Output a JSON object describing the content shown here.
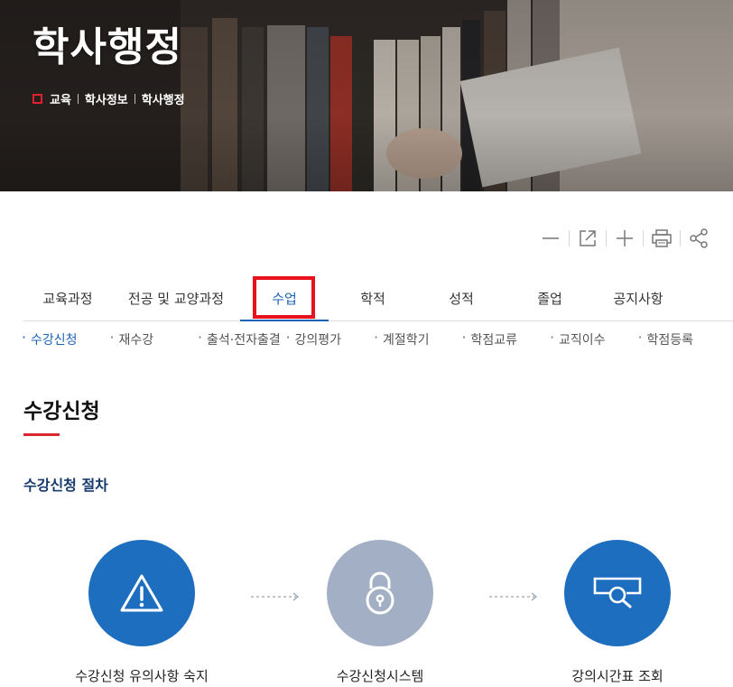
{
  "hero": {
    "title": "학사행정",
    "breadcrumb": [
      "교육",
      "학사정보",
      "학사행정"
    ]
  },
  "utility": {
    "icons": [
      "zoom-out-icon",
      "external-link-icon",
      "zoom-in-icon",
      "print-icon",
      "share-icon"
    ]
  },
  "tabs": [
    {
      "label": "교육과정",
      "active": false
    },
    {
      "label": "전공 및 교양과정",
      "active": false
    },
    {
      "label": "수업",
      "active": true
    },
    {
      "label": "학적",
      "active": false
    },
    {
      "label": "성적",
      "active": false
    },
    {
      "label": "졸업",
      "active": false
    },
    {
      "label": "공지사항",
      "active": false
    }
  ],
  "subtabs": [
    {
      "label": "수강신청",
      "active": true
    },
    {
      "label": "재수강",
      "active": false
    },
    {
      "label": "출석·전자출결",
      "active": false
    },
    {
      "label": "강의평가",
      "active": false
    },
    {
      "label": "계절학기",
      "active": false
    },
    {
      "label": "학점교류",
      "active": false
    },
    {
      "label": "교직이수",
      "active": false
    },
    {
      "label": "학점등록",
      "active": false
    }
  ],
  "page": {
    "heading": "수강신청",
    "section_title": "수강신청 절차"
  },
  "steps": [
    {
      "label": "수강신청 유의사항 숙지",
      "icon": "warning-icon",
      "color": "#1e6ec0"
    },
    {
      "label": "수강신청시스템",
      "icon": "lock-icon",
      "color": "#a3afc4"
    },
    {
      "label": "강의시간표 조회",
      "icon": "search-icon",
      "color": "#1e6ec0"
    }
  ],
  "colors": {
    "accent": "#1d63b5",
    "highlight": "#e8121c",
    "heading_bar": "#d9272e"
  }
}
